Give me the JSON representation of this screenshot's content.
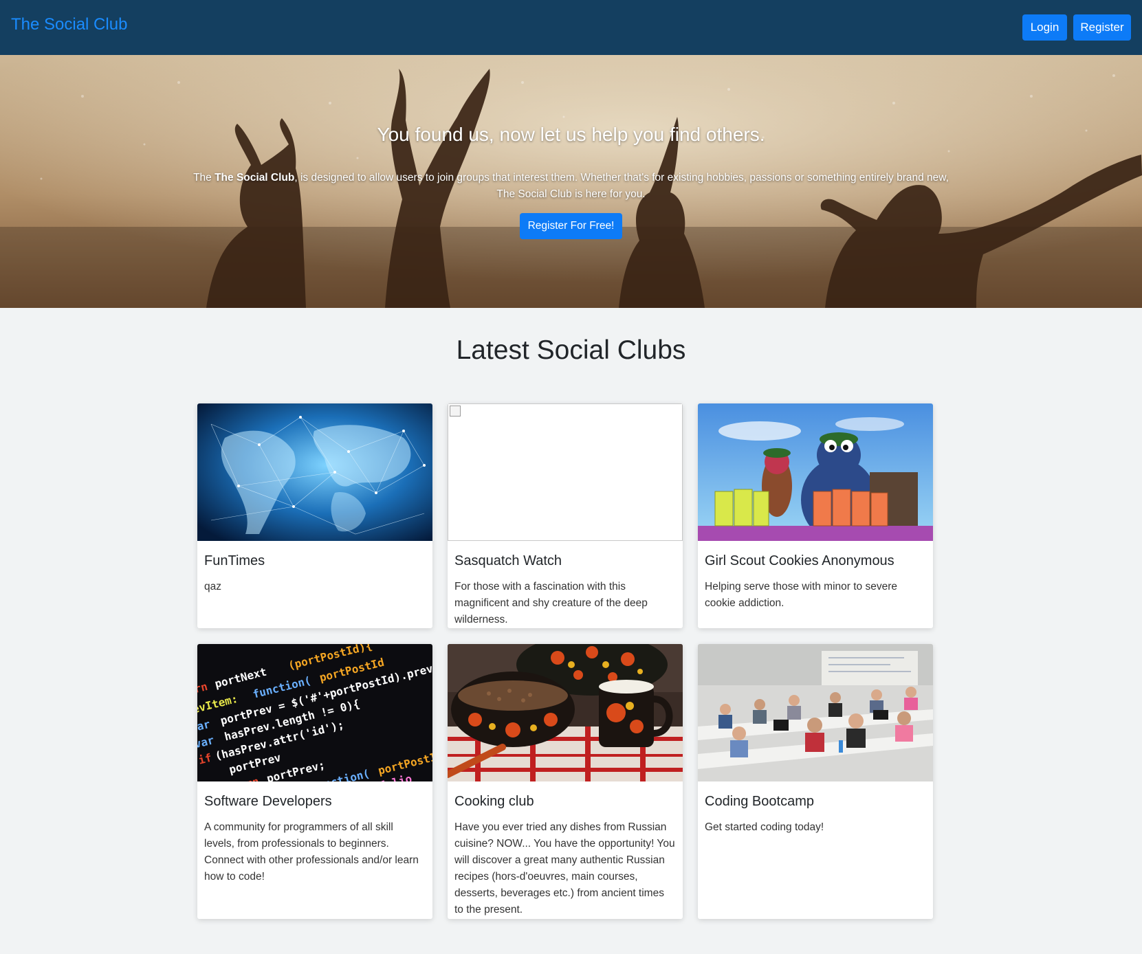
{
  "navbar": {
    "brand": "The Social Club",
    "login_label": "Login",
    "register_label": "Register"
  },
  "hero": {
    "title": "You found us, now let us help you find others.",
    "text_prefix": "The ",
    "text_brand": "The Social Club",
    "text_rest": ", is designed to allow users to join groups that interest them. Whether that's for existing hobbies, passions or something entirely brand new, The Social Club is here for you.",
    "cta_label": "Register For Free!"
  },
  "section": {
    "title": "Latest Social Clubs"
  },
  "clubs": [
    {
      "title": "FunTimes",
      "description": "qaz",
      "image": "world-network-image"
    },
    {
      "title": "Sasquatch Watch",
      "description": "For those with a fascination with this magnificent and shy creature of the deep wilderness.",
      "image": "broken-image-icon"
    },
    {
      "title": "Girl Scout Cookies Anonymous",
      "description": "Helping serve those with minor to severe cookie addiction.",
      "image": "puppets-cookies-image"
    },
    {
      "title": "Software Developers",
      "description": "A community for programmers of all skill levels, from professionals to beginners. Connect with other professionals and/or learn how to code!",
      "image": "code-screen-image"
    },
    {
      "title": "Cooking club",
      "description": "Have you ever tried any dishes from Russian cuisine? NOW... You have the opportunity! You will discover a great many authentic Russian recipes (hors-d'oeuvres, main courses, desserts, beverages etc.) from ancient times to the present.",
      "image": "russian-food-image"
    },
    {
      "title": "Coding Bootcamp",
      "description": "Get started coding today!",
      "image": "classroom-image"
    }
  ],
  "colors": {
    "navbar_bg": "#143f60",
    "brand": "#1a8cff",
    "primary_button": "#0d7bf7",
    "page_bg": "#f1f3f4"
  }
}
